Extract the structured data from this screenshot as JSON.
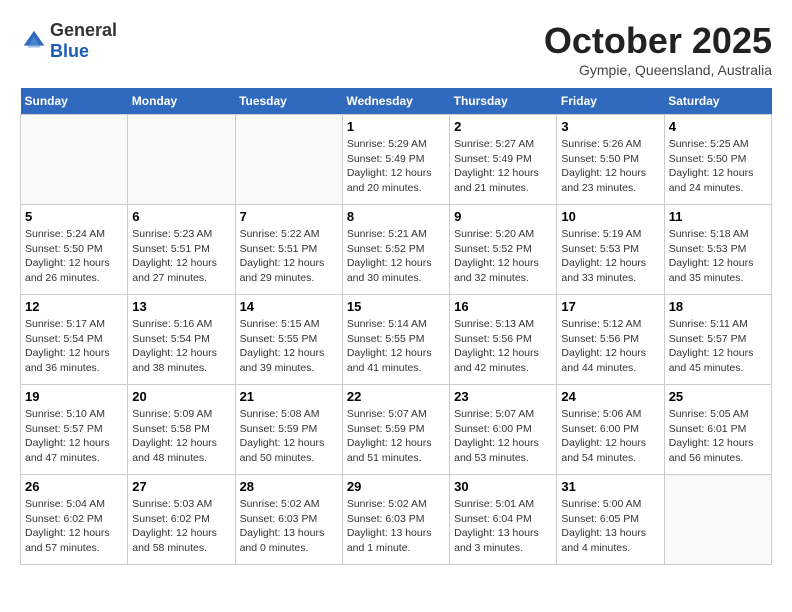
{
  "logo": {
    "text_general": "General",
    "text_blue": "Blue",
    "icon_color": "#2f6abf"
  },
  "header": {
    "month_title": "October 2025",
    "subtitle": "Gympie, Queensland, Australia"
  },
  "days_of_week": [
    "Sunday",
    "Monday",
    "Tuesday",
    "Wednesday",
    "Thursday",
    "Friday",
    "Saturday"
  ],
  "weeks": [
    [
      {
        "day": "",
        "sunrise": "",
        "sunset": "",
        "daylight": ""
      },
      {
        "day": "",
        "sunrise": "",
        "sunset": "",
        "daylight": ""
      },
      {
        "day": "",
        "sunrise": "",
        "sunset": "",
        "daylight": ""
      },
      {
        "day": "1",
        "sunrise": "Sunrise: 5:29 AM",
        "sunset": "Sunset: 5:49 PM",
        "daylight": "Daylight: 12 hours and 20 minutes."
      },
      {
        "day": "2",
        "sunrise": "Sunrise: 5:27 AM",
        "sunset": "Sunset: 5:49 PM",
        "daylight": "Daylight: 12 hours and 21 minutes."
      },
      {
        "day": "3",
        "sunrise": "Sunrise: 5:26 AM",
        "sunset": "Sunset: 5:50 PM",
        "daylight": "Daylight: 12 hours and 23 minutes."
      },
      {
        "day": "4",
        "sunrise": "Sunrise: 5:25 AM",
        "sunset": "Sunset: 5:50 PM",
        "daylight": "Daylight: 12 hours and 24 minutes."
      }
    ],
    [
      {
        "day": "5",
        "sunrise": "Sunrise: 5:24 AM",
        "sunset": "Sunset: 5:50 PM",
        "daylight": "Daylight: 12 hours and 26 minutes."
      },
      {
        "day": "6",
        "sunrise": "Sunrise: 5:23 AM",
        "sunset": "Sunset: 5:51 PM",
        "daylight": "Daylight: 12 hours and 27 minutes."
      },
      {
        "day": "7",
        "sunrise": "Sunrise: 5:22 AM",
        "sunset": "Sunset: 5:51 PM",
        "daylight": "Daylight: 12 hours and 29 minutes."
      },
      {
        "day": "8",
        "sunrise": "Sunrise: 5:21 AM",
        "sunset": "Sunset: 5:52 PM",
        "daylight": "Daylight: 12 hours and 30 minutes."
      },
      {
        "day": "9",
        "sunrise": "Sunrise: 5:20 AM",
        "sunset": "Sunset: 5:52 PM",
        "daylight": "Daylight: 12 hours and 32 minutes."
      },
      {
        "day": "10",
        "sunrise": "Sunrise: 5:19 AM",
        "sunset": "Sunset: 5:53 PM",
        "daylight": "Daylight: 12 hours and 33 minutes."
      },
      {
        "day": "11",
        "sunrise": "Sunrise: 5:18 AM",
        "sunset": "Sunset: 5:53 PM",
        "daylight": "Daylight: 12 hours and 35 minutes."
      }
    ],
    [
      {
        "day": "12",
        "sunrise": "Sunrise: 5:17 AM",
        "sunset": "Sunset: 5:54 PM",
        "daylight": "Daylight: 12 hours and 36 minutes."
      },
      {
        "day": "13",
        "sunrise": "Sunrise: 5:16 AM",
        "sunset": "Sunset: 5:54 PM",
        "daylight": "Daylight: 12 hours and 38 minutes."
      },
      {
        "day": "14",
        "sunrise": "Sunrise: 5:15 AM",
        "sunset": "Sunset: 5:55 PM",
        "daylight": "Daylight: 12 hours and 39 minutes."
      },
      {
        "day": "15",
        "sunrise": "Sunrise: 5:14 AM",
        "sunset": "Sunset: 5:55 PM",
        "daylight": "Daylight: 12 hours and 41 minutes."
      },
      {
        "day": "16",
        "sunrise": "Sunrise: 5:13 AM",
        "sunset": "Sunset: 5:56 PM",
        "daylight": "Daylight: 12 hours and 42 minutes."
      },
      {
        "day": "17",
        "sunrise": "Sunrise: 5:12 AM",
        "sunset": "Sunset: 5:56 PM",
        "daylight": "Daylight: 12 hours and 44 minutes."
      },
      {
        "day": "18",
        "sunrise": "Sunrise: 5:11 AM",
        "sunset": "Sunset: 5:57 PM",
        "daylight": "Daylight: 12 hours and 45 minutes."
      }
    ],
    [
      {
        "day": "19",
        "sunrise": "Sunrise: 5:10 AM",
        "sunset": "Sunset: 5:57 PM",
        "daylight": "Daylight: 12 hours and 47 minutes."
      },
      {
        "day": "20",
        "sunrise": "Sunrise: 5:09 AM",
        "sunset": "Sunset: 5:58 PM",
        "daylight": "Daylight: 12 hours and 48 minutes."
      },
      {
        "day": "21",
        "sunrise": "Sunrise: 5:08 AM",
        "sunset": "Sunset: 5:59 PM",
        "daylight": "Daylight: 12 hours and 50 minutes."
      },
      {
        "day": "22",
        "sunrise": "Sunrise: 5:07 AM",
        "sunset": "Sunset: 5:59 PM",
        "daylight": "Daylight: 12 hours and 51 minutes."
      },
      {
        "day": "23",
        "sunrise": "Sunrise: 5:07 AM",
        "sunset": "Sunset: 6:00 PM",
        "daylight": "Daylight: 12 hours and 53 minutes."
      },
      {
        "day": "24",
        "sunrise": "Sunrise: 5:06 AM",
        "sunset": "Sunset: 6:00 PM",
        "daylight": "Daylight: 12 hours and 54 minutes."
      },
      {
        "day": "25",
        "sunrise": "Sunrise: 5:05 AM",
        "sunset": "Sunset: 6:01 PM",
        "daylight": "Daylight: 12 hours and 56 minutes."
      }
    ],
    [
      {
        "day": "26",
        "sunrise": "Sunrise: 5:04 AM",
        "sunset": "Sunset: 6:02 PM",
        "daylight": "Daylight: 12 hours and 57 minutes."
      },
      {
        "day": "27",
        "sunrise": "Sunrise: 5:03 AM",
        "sunset": "Sunset: 6:02 PM",
        "daylight": "Daylight: 12 hours and 58 minutes."
      },
      {
        "day": "28",
        "sunrise": "Sunrise: 5:02 AM",
        "sunset": "Sunset: 6:03 PM",
        "daylight": "Daylight: 13 hours and 0 minutes."
      },
      {
        "day": "29",
        "sunrise": "Sunrise: 5:02 AM",
        "sunset": "Sunset: 6:03 PM",
        "daylight": "Daylight: 13 hours and 1 minute."
      },
      {
        "day": "30",
        "sunrise": "Sunrise: 5:01 AM",
        "sunset": "Sunset: 6:04 PM",
        "daylight": "Daylight: 13 hours and 3 minutes."
      },
      {
        "day": "31",
        "sunrise": "Sunrise: 5:00 AM",
        "sunset": "Sunset: 6:05 PM",
        "daylight": "Daylight: 13 hours and 4 minutes."
      },
      {
        "day": "",
        "sunrise": "",
        "sunset": "",
        "daylight": ""
      }
    ]
  ]
}
